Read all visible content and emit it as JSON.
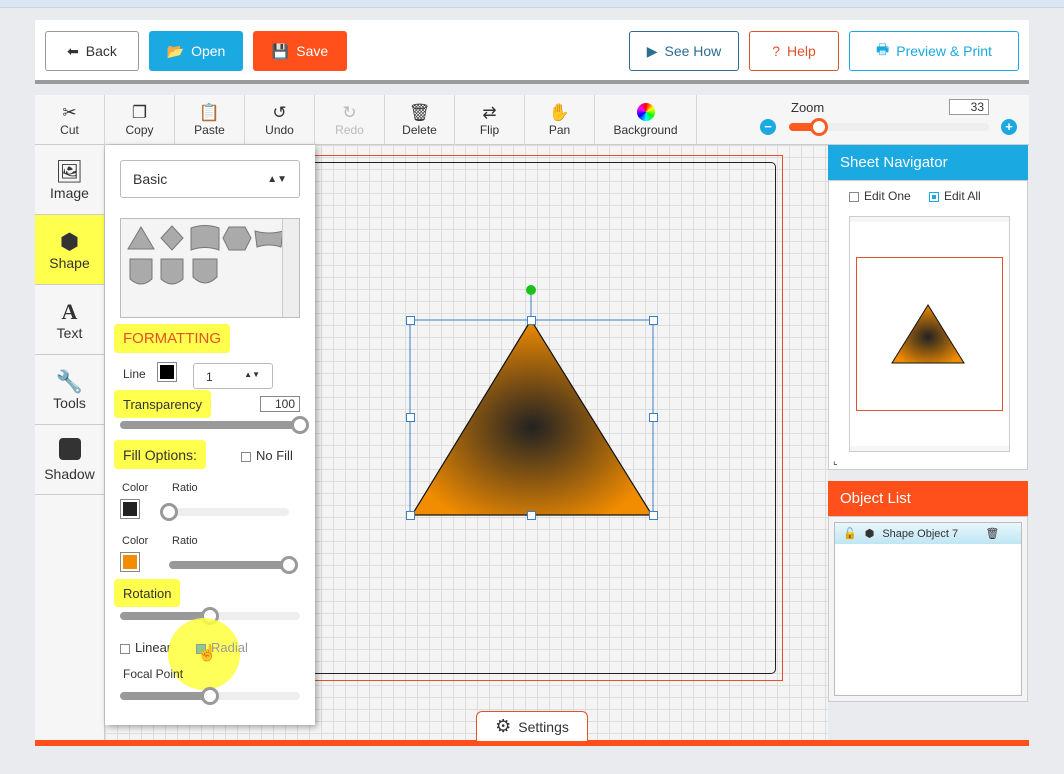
{
  "header": {
    "back": "Back",
    "open": "Open",
    "save": "Save",
    "see_how": "See How",
    "help": "Help",
    "preview": "Preview & Print"
  },
  "toolbar": {
    "cut": "Cut",
    "copy": "Copy",
    "paste": "Paste",
    "undo": "Undo",
    "redo": "Redo",
    "delete": "Delete",
    "flip": "Flip",
    "pan": "Pan",
    "background": "Background",
    "zoom_label": "Zoom",
    "zoom_value": "33",
    "zoom_fraction": 0.15
  },
  "sidebar": {
    "items": [
      {
        "label": "Image",
        "icon": "image-icon"
      },
      {
        "label": "Shape",
        "icon": "cube-icon",
        "active": true
      },
      {
        "label": "Text",
        "icon": "text-icon"
      },
      {
        "label": "Tools",
        "icon": "wrench-icon"
      },
      {
        "label": "Shadow",
        "icon": "shadow-icon"
      }
    ]
  },
  "panel": {
    "category": "Basic",
    "formatting": "FORMATTING",
    "line_label": "Line",
    "line_color": "#000000",
    "line_width": "1",
    "transparency_label": "Transparency",
    "transparency_value": "100",
    "transparency_fraction": 1.0,
    "fill_options": "Fill Options:",
    "no_fill": "No Fill",
    "color_label": "Color",
    "ratio_label": "Ratio",
    "color1": "#222222",
    "ratio1": 0.0,
    "color2": "#f28c00",
    "ratio2": 1.0,
    "rotation_label": "Rotation",
    "rotation_fraction": 0.5,
    "linear": "Linear",
    "radial": "Radial",
    "radial_checked": true,
    "focal_label": "Focal Point",
    "focal_fraction": 0.5
  },
  "navigator": {
    "title": "Sheet Navigator",
    "edit_one": "Edit One",
    "edit_all": "Edit All",
    "edit_all_checked": true
  },
  "object_list": {
    "title": "Object List",
    "items": [
      {
        "name": "Shape Object 7"
      }
    ]
  },
  "settings": "Settings",
  "colors": {
    "accent_blue": "#1aa9e0",
    "accent_orange": "#ff5a1f",
    "highlight": "#ffff4d"
  }
}
